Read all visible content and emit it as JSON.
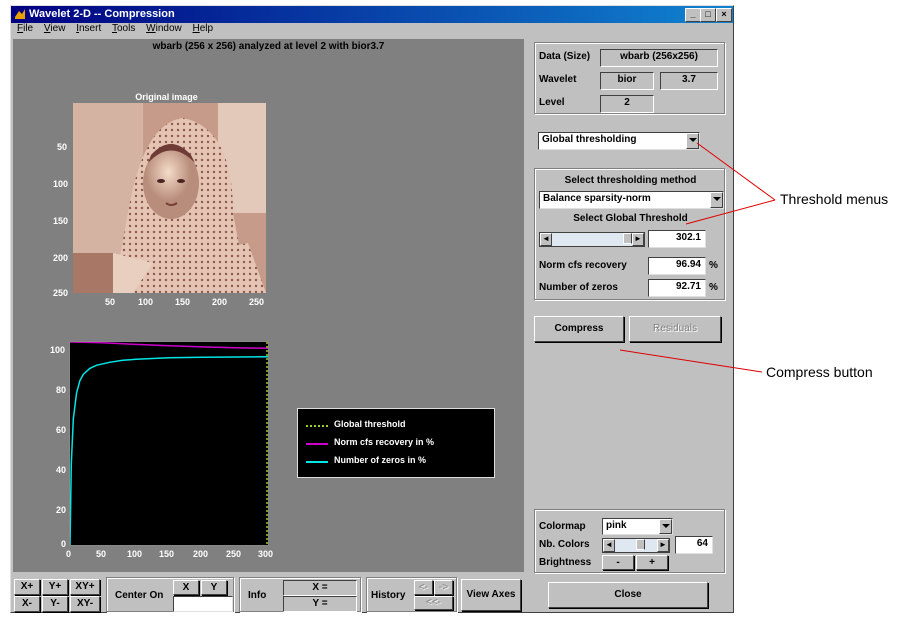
{
  "window": {
    "title": "Wavelet 2-D  --  Compression",
    "menu": [
      "File",
      "View",
      "Insert",
      "Tools",
      "Window",
      "Help"
    ]
  },
  "plot": {
    "analysis_title": "wbarb (256 x 256) analyzed at level 2 with bior3.7",
    "image_title": "Original image",
    "image_yticks": [
      "50",
      "100",
      "150",
      "200",
      "250"
    ],
    "image_xticks": [
      "50",
      "100",
      "150",
      "200",
      "250"
    ],
    "curve_yticks": [
      "100",
      "80",
      "60",
      "40",
      "20",
      "0"
    ],
    "curve_xticks": [
      "0",
      "50",
      "100",
      "150",
      "200",
      "250",
      "300"
    ],
    "legend": [
      {
        "label": "Global threshold",
        "color": "#9acd32"
      },
      {
        "label": "Norm cfs recovery in %",
        "color": "#cc00cc"
      },
      {
        "label": "Number of zeros in %",
        "color": "#00e5e5"
      }
    ]
  },
  "chart_data": {
    "type": "line",
    "xlim": [
      0,
      300
    ],
    "ylim": [
      0,
      100
    ],
    "series": [
      {
        "name": "Norm cfs recovery in %",
        "x": [
          0,
          20,
          50,
          100,
          150,
          200,
          250,
          300
        ],
        "y": [
          100,
          99.9,
          99.6,
          98.8,
          98.2,
          97.6,
          97.2,
          96.9
        ]
      },
      {
        "name": "Number of zeros in %",
        "x": [
          0,
          2,
          5,
          10,
          15,
          20,
          30,
          40,
          60,
          80,
          100,
          150,
          200,
          250,
          300
        ],
        "y": [
          0,
          40,
          62,
          75,
          81,
          84,
          87,
          88.5,
          90,
          91,
          91.5,
          92.2,
          92.5,
          92.6,
          92.7
        ]
      }
    ],
    "threshold": 302.1
  },
  "right_panel": {
    "data_label": "Data  (Size)",
    "data_value": "wbarb  (256x256)",
    "wavelet_label": "Wavelet",
    "wavelet_family": "bior",
    "wavelet_number": "3.7",
    "level_label": "Level",
    "level_value": "2",
    "threshold_menu": "Global thresholding",
    "method_title": "Select thresholding method",
    "method_value": "Balance sparsity-norm",
    "global_title": "Select Global Threshold",
    "threshold_value": "302.1",
    "norm_label": "Norm cfs recovery",
    "norm_value": "96.94",
    "norm_unit": "%",
    "zeros_label": "Number of zeros",
    "zeros_value": "92.71",
    "zeros_unit": "%",
    "compress_label": "Compress",
    "residuals_label": "Residuals",
    "colormap_label": "Colormap",
    "colormap_value": "pink",
    "nbcolors_label": "Nb. Colors",
    "nbcolors_value": "64",
    "brightness_label": "Brightness",
    "brightness_minus": "-",
    "brightness_plus": "+",
    "close_label": "Close"
  },
  "bottom_bar": {
    "xplus": "X+",
    "yplus": "Y+",
    "xyplus": "XY+",
    "xminus": "X-",
    "yminus": "Y-",
    "xyminus": "XY-",
    "center_on": "Center On",
    "x": "X",
    "y": "Y",
    "info": "Info",
    "x_eq": "X =",
    "y_eq": "Y =",
    "history": "History",
    "hist_left": "<-",
    "hist_right": "->",
    "hist_back": "<<-",
    "view_axes": "View Axes"
  },
  "annotations": {
    "threshold_menus": "Threshold menus",
    "compress_button": "Compress button"
  }
}
